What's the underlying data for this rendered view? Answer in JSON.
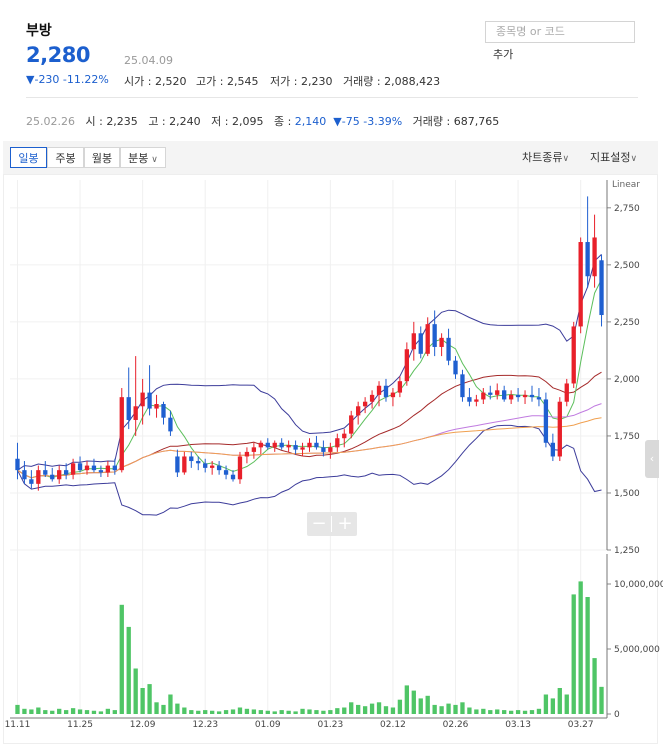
{
  "header": {
    "name": "부방",
    "price": "2,280",
    "date": "25.04.09",
    "change": "-230 -11.22%",
    "open_label": "시가",
    "open_value": "2,520",
    "high_label": "고가",
    "high_value": "2,545",
    "low_label": "저가",
    "low_value": "2,230",
    "volume_label": "거래량",
    "volume_value": "2,088,423"
  },
  "search": {
    "placeholder": "종목명 or 코드",
    "add_label": "추가"
  },
  "previous": {
    "date": "25.02.26",
    "open_label": "시",
    "open_value": "2,235",
    "high_label": "고",
    "high_value": "2,240",
    "low_label": "저",
    "low_value": "2,095",
    "close_label": "종",
    "close_value": "2,140",
    "change": "-75 -3.39%",
    "volume_label": "거래량",
    "volume_value": "687,765"
  },
  "toolbar": {
    "tabs": [
      "일봉",
      "주봉",
      "월봉",
      "분봉"
    ],
    "active_tab": "일봉",
    "chart_type": "차트종류",
    "indicator_settings": "지표설정"
  },
  "colors": {
    "up": "#e8202a",
    "down": "#1f5fd0",
    "volume": "#4fc566",
    "accent": "#1c5fce"
  },
  "chart_data": {
    "type": "candlestick",
    "price_axis": {
      "scale_label": "Linear",
      "ticks": [
        1250,
        1500,
        1750,
        2000,
        2250,
        2500,
        2750
      ],
      "ylim": [
        1250,
        2850
      ]
    },
    "volume_axis": {
      "ticks": [
        0,
        5000000,
        10000000
      ],
      "tick_labels": [
        "0",
        "5,000,000",
        "10,000,000"
      ],
      "ylim": [
        0,
        12000000
      ]
    },
    "x_tick_labels": [
      "11.11",
      "11.25",
      "12.09",
      "12.23",
      "01.09",
      "01.23",
      "02.12",
      "02.26",
      "03.13",
      "03.27"
    ],
    "candles": [
      {
        "o": 1650,
        "h": 1720,
        "l": 1560,
        "c": 1600,
        "v": 700000
      },
      {
        "o": 1600,
        "h": 1640,
        "l": 1540,
        "c": 1560,
        "v": 400000
      },
      {
        "o": 1560,
        "h": 1600,
        "l": 1520,
        "c": 1540,
        "v": 350000
      },
      {
        "o": 1540,
        "h": 1620,
        "l": 1510,
        "c": 1600,
        "v": 500000
      },
      {
        "o": 1600,
        "h": 1640,
        "l": 1570,
        "c": 1580,
        "v": 300000
      },
      {
        "o": 1580,
        "h": 1610,
        "l": 1550,
        "c": 1560,
        "v": 250000
      },
      {
        "o": 1560,
        "h": 1620,
        "l": 1540,
        "c": 1600,
        "v": 400000
      },
      {
        "o": 1600,
        "h": 1630,
        "l": 1560,
        "c": 1580,
        "v": 300000
      },
      {
        "o": 1580,
        "h": 1650,
        "l": 1560,
        "c": 1630,
        "v": 450000
      },
      {
        "o": 1630,
        "h": 1660,
        "l": 1590,
        "c": 1600,
        "v": 350000
      },
      {
        "o": 1600,
        "h": 1640,
        "l": 1580,
        "c": 1620,
        "v": 300000
      },
      {
        "o": 1620,
        "h": 1650,
        "l": 1590,
        "c": 1600,
        "v": 250000
      },
      {
        "o": 1600,
        "h": 1620,
        "l": 1570,
        "c": 1590,
        "v": 200000
      },
      {
        "o": 1590,
        "h": 1640,
        "l": 1570,
        "c": 1620,
        "v": 400000
      },
      {
        "o": 1620,
        "h": 1650,
        "l": 1580,
        "c": 1600,
        "v": 300000
      },
      {
        "o": 1600,
        "h": 1960,
        "l": 1590,
        "c": 1920,
        "v": 8400000
      },
      {
        "o": 1920,
        "h": 2050,
        "l": 1780,
        "c": 1820,
        "v": 6700000
      },
      {
        "o": 1820,
        "h": 2100,
        "l": 1750,
        "c": 1880,
        "v": 3500000
      },
      {
        "o": 1880,
        "h": 2000,
        "l": 1800,
        "c": 1940,
        "v": 2000000
      },
      {
        "o": 1940,
        "h": 2060,
        "l": 1840,
        "c": 1870,
        "v": 2300000
      },
      {
        "o": 1870,
        "h": 1930,
        "l": 1830,
        "c": 1890,
        "v": 900000
      },
      {
        "o": 1890,
        "h": 1900,
        "l": 1800,
        "c": 1830,
        "v": 700000
      },
      {
        "o": 1830,
        "h": 1860,
        "l": 1750,
        "c": 1770,
        "v": 1500000
      },
      {
        "o": 1660,
        "h": 1690,
        "l": 1570,
        "c": 1590,
        "v": 800000
      },
      {
        "o": 1590,
        "h": 1680,
        "l": 1580,
        "c": 1660,
        "v": 500000
      },
      {
        "o": 1660,
        "h": 1680,
        "l": 1610,
        "c": 1640,
        "v": 300000
      },
      {
        "o": 1640,
        "h": 1660,
        "l": 1600,
        "c": 1630,
        "v": 250000
      },
      {
        "o": 1630,
        "h": 1650,
        "l": 1590,
        "c": 1610,
        "v": 300000
      },
      {
        "o": 1610,
        "h": 1640,
        "l": 1580,
        "c": 1620,
        "v": 250000
      },
      {
        "o": 1620,
        "h": 1640,
        "l": 1580,
        "c": 1600,
        "v": 200000
      },
      {
        "o": 1600,
        "h": 1620,
        "l": 1560,
        "c": 1580,
        "v": 300000
      },
      {
        "o": 1580,
        "h": 1600,
        "l": 1550,
        "c": 1560,
        "v": 350000
      },
      {
        "o": 1560,
        "h": 1680,
        "l": 1540,
        "c": 1660,
        "v": 500000
      },
      {
        "o": 1660,
        "h": 1700,
        "l": 1630,
        "c": 1680,
        "v": 400000
      },
      {
        "o": 1680,
        "h": 1720,
        "l": 1650,
        "c": 1700,
        "v": 350000
      },
      {
        "o": 1700,
        "h": 1730,
        "l": 1670,
        "c": 1720,
        "v": 300000
      },
      {
        "o": 1720,
        "h": 1740,
        "l": 1690,
        "c": 1700,
        "v": 250000
      },
      {
        "o": 1700,
        "h": 1730,
        "l": 1680,
        "c": 1720,
        "v": 200000
      },
      {
        "o": 1720,
        "h": 1740,
        "l": 1690,
        "c": 1700,
        "v": 300000
      },
      {
        "o": 1700,
        "h": 1730,
        "l": 1680,
        "c": 1710,
        "v": 250000
      },
      {
        "o": 1710,
        "h": 1730,
        "l": 1670,
        "c": 1690,
        "v": 200000
      },
      {
        "o": 1690,
        "h": 1720,
        "l": 1660,
        "c": 1700,
        "v": 400000
      },
      {
        "o": 1700,
        "h": 1740,
        "l": 1680,
        "c": 1720,
        "v": 350000
      },
      {
        "o": 1720,
        "h": 1750,
        "l": 1690,
        "c": 1700,
        "v": 300000
      },
      {
        "o": 1700,
        "h": 1730,
        "l": 1660,
        "c": 1680,
        "v": 250000
      },
      {
        "o": 1680,
        "h": 1720,
        "l": 1650,
        "c": 1700,
        "v": 300000
      },
      {
        "o": 1700,
        "h": 1760,
        "l": 1680,
        "c": 1740,
        "v": 450000
      },
      {
        "o": 1740,
        "h": 1780,
        "l": 1700,
        "c": 1760,
        "v": 500000
      },
      {
        "o": 1760,
        "h": 1860,
        "l": 1740,
        "c": 1840,
        "v": 900000
      },
      {
        "o": 1840,
        "h": 1900,
        "l": 1800,
        "c": 1880,
        "v": 700000
      },
      {
        "o": 1880,
        "h": 1920,
        "l": 1850,
        "c": 1900,
        "v": 600000
      },
      {
        "o": 1900,
        "h": 1950,
        "l": 1870,
        "c": 1930,
        "v": 800000
      },
      {
        "o": 1930,
        "h": 1990,
        "l": 1880,
        "c": 1970,
        "v": 900000
      },
      {
        "o": 1970,
        "h": 2000,
        "l": 1900,
        "c": 1920,
        "v": 600000
      },
      {
        "o": 1920,
        "h": 1960,
        "l": 1880,
        "c": 1940,
        "v": 500000
      },
      {
        "o": 1940,
        "h": 2010,
        "l": 1920,
        "c": 1990,
        "v": 1100000
      },
      {
        "o": 1990,
        "h": 2160,
        "l": 1970,
        "c": 2130,
        "v": 2200000
      },
      {
        "o": 2130,
        "h": 2250,
        "l": 2080,
        "c": 2200,
        "v": 1800000
      },
      {
        "o": 2200,
        "h": 2230,
        "l": 2090,
        "c": 2110,
        "v": 1200000
      },
      {
        "o": 2110,
        "h": 2270,
        "l": 2100,
        "c": 2240,
        "v": 1400000
      },
      {
        "o": 2240,
        "h": 2300,
        "l": 2100,
        "c": 2140,
        "v": 700000
      },
      {
        "o": 2140,
        "h": 2200,
        "l": 2100,
        "c": 2180,
        "v": 600000
      },
      {
        "o": 2180,
        "h": 2220,
        "l": 2060,
        "c": 2080,
        "v": 800000
      },
      {
        "o": 2080,
        "h": 2100,
        "l": 2000,
        "c": 2020,
        "v": 700000
      },
      {
        "o": 2020,
        "h": 2040,
        "l": 1900,
        "c": 1920,
        "v": 900000
      },
      {
        "o": 1920,
        "h": 1960,
        "l": 1880,
        "c": 1900,
        "v": 500000
      },
      {
        "o": 1900,
        "h": 1930,
        "l": 1880,
        "c": 1910,
        "v": 350000
      },
      {
        "o": 1910,
        "h": 1960,
        "l": 1890,
        "c": 1940,
        "v": 400000
      },
      {
        "o": 1940,
        "h": 1970,
        "l": 1910,
        "c": 1930,
        "v": 300000
      },
      {
        "o": 1930,
        "h": 1980,
        "l": 1910,
        "c": 1950,
        "v": 350000
      },
      {
        "o": 1950,
        "h": 1970,
        "l": 1900,
        "c": 1910,
        "v": 300000
      },
      {
        "o": 1910,
        "h": 1950,
        "l": 1890,
        "c": 1930,
        "v": 250000
      },
      {
        "o": 1930,
        "h": 1960,
        "l": 1900,
        "c": 1920,
        "v": 300000
      },
      {
        "o": 1920,
        "h": 1950,
        "l": 1890,
        "c": 1930,
        "v": 250000
      },
      {
        "o": 1930,
        "h": 1970,
        "l": 1900,
        "c": 1920,
        "v": 300000
      },
      {
        "o": 1920,
        "h": 1960,
        "l": 1880,
        "c": 1910,
        "v": 400000
      },
      {
        "o": 1910,
        "h": 1940,
        "l": 1700,
        "c": 1720,
        "v": 1500000
      },
      {
        "o": 1720,
        "h": 1760,
        "l": 1640,
        "c": 1660,
        "v": 1200000
      },
      {
        "o": 1660,
        "h": 1920,
        "l": 1640,
        "c": 1900,
        "v": 2000000
      },
      {
        "o": 1900,
        "h": 2000,
        "l": 1880,
        "c": 1980,
        "v": 1500000
      },
      {
        "o": 1980,
        "h": 2250,
        "l": 1960,
        "c": 2230,
        "v": 9200000
      },
      {
        "o": 2230,
        "h": 2620,
        "l": 2200,
        "c": 2600,
        "v": 10200000
      },
      {
        "o": 2600,
        "h": 2800,
        "l": 2400,
        "c": 2450,
        "v": 9000000
      },
      {
        "o": 2450,
        "h": 2720,
        "l": 2400,
        "c": 2620,
        "v": 4300000
      },
      {
        "o": 2520,
        "h": 2545,
        "l": 2230,
        "c": 2280,
        "v": 2088423
      }
    ]
  }
}
